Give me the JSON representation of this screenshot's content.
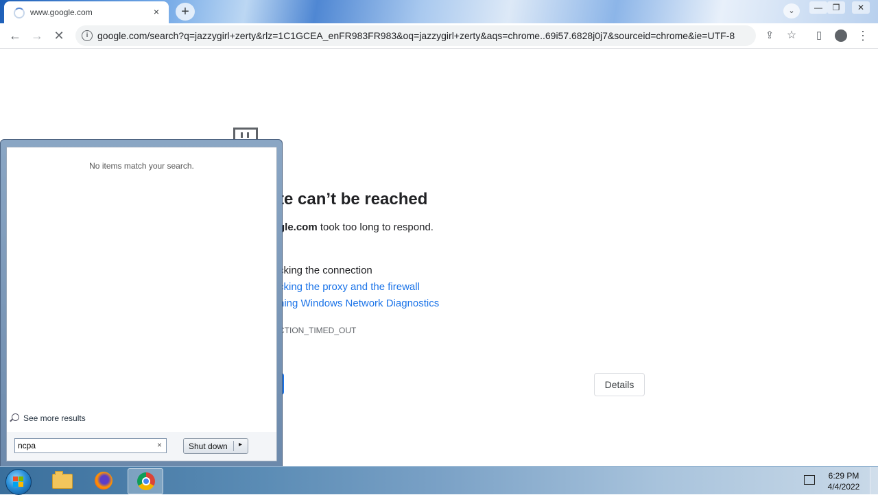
{
  "browser": {
    "tab_title": "www.google.com",
    "tab_close": "×",
    "new_tab": "+",
    "url": "google.com/search?q=jazzygirl+zerty&rlz=1C1GCEA_enFR983FR983&oq=jazzygirl+zerty&aqs=chrome..69i57.6828j0j7&sourceid=chrome&ie=UTF-8",
    "icons": [
      "back-icon",
      "forward-icon",
      "stop-icon",
      "info-icon",
      "share-icon",
      "star-icon",
      "side-panel-icon",
      "profile-icon",
      "menu-icon"
    ]
  },
  "error_page": {
    "title": "te can’t be reached",
    "host": "gle.com",
    "host_suffix": " took too long to respond.",
    "try_label_1": "cking the connection",
    "try_link_2": "cking the proxy and the firewall",
    "try_link_3": "ning Windows Network Diagnostics",
    "error_code": "CTION_TIMED_OUT",
    "details_button": "Details"
  },
  "start_menu": {
    "no_results": "No items match your search.",
    "see_more": "See more results",
    "search_value": "ncpa",
    "clear": "×",
    "shutdown_label": "Shut down",
    "shutdown_arrow": "▸"
  },
  "taskbar": {
    "time": "6:29 PM",
    "date": "4/4/2022",
    "pinned": [
      "windows-explorer",
      "firefox",
      "chrome"
    ]
  },
  "colors": {
    "link": "#1a73e8",
    "text": "#202124"
  }
}
